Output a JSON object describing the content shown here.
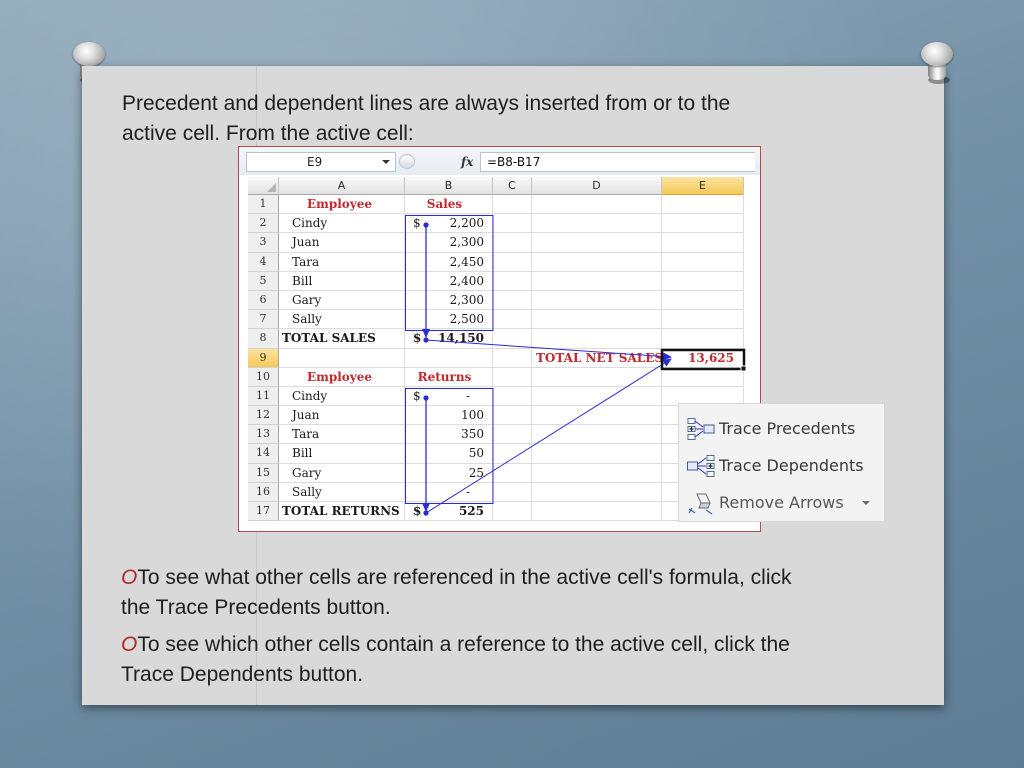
{
  "slide": {
    "intro": "Precedent and dependent lines are always inserted from or to the active cell. From the active cell:",
    "bullets": [
      {
        "marker": "O",
        "before": "To see what other cells are referenced in the active cell's formula, click the ",
        "strong": "Trace Precedents",
        "after": " button."
      },
      {
        "marker": "O",
        "before": "To see which other cells contain a reference to the active cell, click the ",
        "strong": "Trace Dependents",
        "after": " button."
      }
    ],
    "colors": {
      "bullet_marker": "#b5272d",
      "text": "#1e1e1e",
      "panel": "#d9d9d9"
    }
  },
  "excel": {
    "name_box": "E9",
    "fx_label": "fx",
    "formula": "=B8-B17",
    "col_headers": [
      "A",
      "B",
      "C",
      "D",
      "E"
    ],
    "active_column": "E",
    "active_row": "9",
    "rows": [
      {
        "num": "1",
        "a": "Employee",
        "b_sym": "",
        "b": "Sales",
        "c": "",
        "d": "",
        "e": ""
      },
      {
        "num": "2",
        "a": "Cindy",
        "b_sym": "$",
        "b": "2,200",
        "c": "",
        "d": "",
        "e": ""
      },
      {
        "num": "3",
        "a": "Juan",
        "b_sym": "",
        "b": "2,300",
        "c": "",
        "d": "",
        "e": ""
      },
      {
        "num": "4",
        "a": "Tara",
        "b_sym": "",
        "b": "2,450",
        "c": "",
        "d": "",
        "e": ""
      },
      {
        "num": "5",
        "a": "Bill",
        "b_sym": "",
        "b": "2,400",
        "c": "",
        "d": "",
        "e": ""
      },
      {
        "num": "6",
        "a": "Gary",
        "b_sym": "",
        "b": "2,300",
        "c": "",
        "d": "",
        "e": ""
      },
      {
        "num": "7",
        "a": "Sally",
        "b_sym": "",
        "b": "2,500",
        "c": "",
        "d": "",
        "e": ""
      },
      {
        "num": "8",
        "a": "TOTAL SALES",
        "b_sym": "$",
        "b": "14,150",
        "c": "",
        "d": "",
        "e": ""
      },
      {
        "num": "9",
        "a": "",
        "b_sym": "",
        "b": "",
        "c": "",
        "d": "TOTAL NET SALES",
        "e": "13,625"
      },
      {
        "num": "10",
        "a": "Employee",
        "b_sym": "",
        "b": "Returns",
        "c": "",
        "d": "",
        "e": ""
      },
      {
        "num": "11",
        "a": "Cindy",
        "b_sym": "$",
        "b": "-",
        "c": "",
        "d": "",
        "e": ""
      },
      {
        "num": "12",
        "a": "Juan",
        "b_sym": "",
        "b": "100",
        "c": "",
        "d": "",
        "e": ""
      },
      {
        "num": "13",
        "a": "Tara",
        "b_sym": "",
        "b": "350",
        "c": "",
        "d": "",
        "e": ""
      },
      {
        "num": "14",
        "a": "Bill",
        "b_sym": "",
        "b": "50",
        "c": "",
        "d": "",
        "e": ""
      },
      {
        "num": "15",
        "a": "Gary",
        "b_sym": "",
        "b": "25",
        "c": "",
        "d": "",
        "e": ""
      },
      {
        "num": "16",
        "a": "Sally",
        "b_sym": "",
        "b": "-",
        "c": "",
        "d": "",
        "e": ""
      },
      {
        "num": "17",
        "a": "TOTAL RETURNS",
        "b_sym": "$",
        "b": "525",
        "c": "",
        "d": "",
        "e": ""
      }
    ],
    "colors": {
      "header_text": "#c0282d",
      "trace_arrow": "#2b2bd6",
      "active_header": "#f5c95a",
      "frame_border": "#b8474a"
    }
  },
  "ribbon_menu": {
    "items": [
      {
        "label": "Trace Precedents",
        "icon": "trace-precedents-icon"
      },
      {
        "label": "Trace Dependents",
        "icon": "trace-dependents-icon"
      },
      {
        "label": "Remove Arrows",
        "icon": "remove-arrows-icon",
        "has_dropdown": true
      }
    ]
  }
}
